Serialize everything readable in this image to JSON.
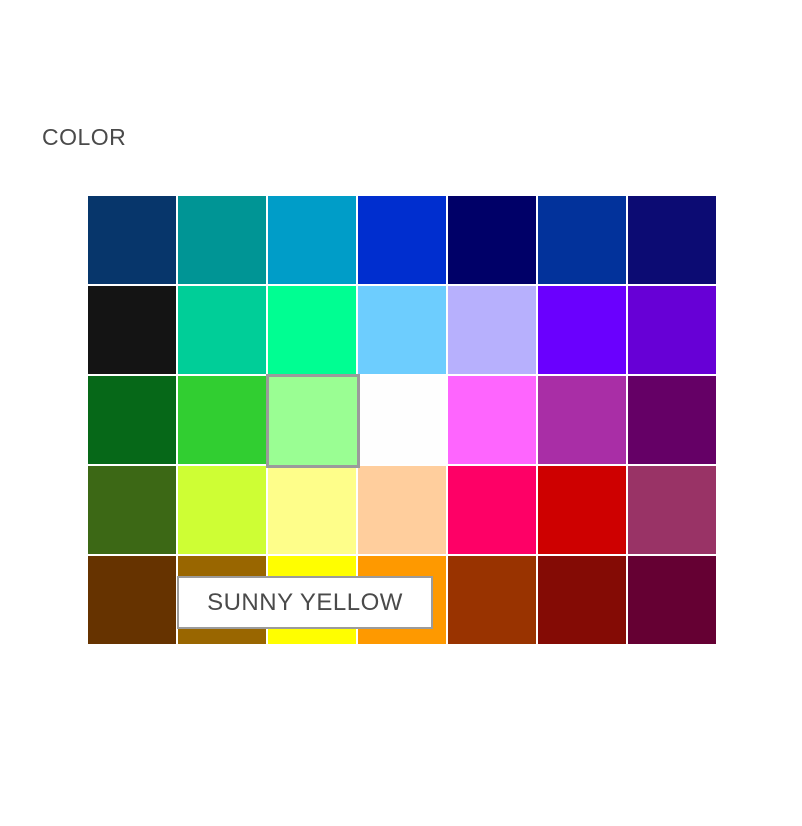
{
  "section_label": "COLOR",
  "tooltip": "SUNNY YELLOW",
  "selected_index": 16,
  "swatches": [
    "#07366b",
    "#009595",
    "#009dc8",
    "#002ecf",
    "#000068",
    "#02329b",
    "#0c0b73",
    "#141414",
    "#00ce98",
    "#00fe92",
    "#6dcdfe",
    "#b7b0fd",
    "#6a00fe",
    "#6700d6",
    "#066818",
    "#31ce31",
    "#9afe93",
    "#fefefe",
    "#fe65fe",
    "#a92ea6",
    "#650066",
    "#3c6815",
    "#cefe34",
    "#fefe8a",
    "#ffce9d",
    "#fe0066",
    "#ce0000",
    "#993366",
    "#663300",
    "#996600",
    "#fffe00",
    "#fe9900",
    "#993300",
    "#840b05",
    "#650033"
  ]
}
